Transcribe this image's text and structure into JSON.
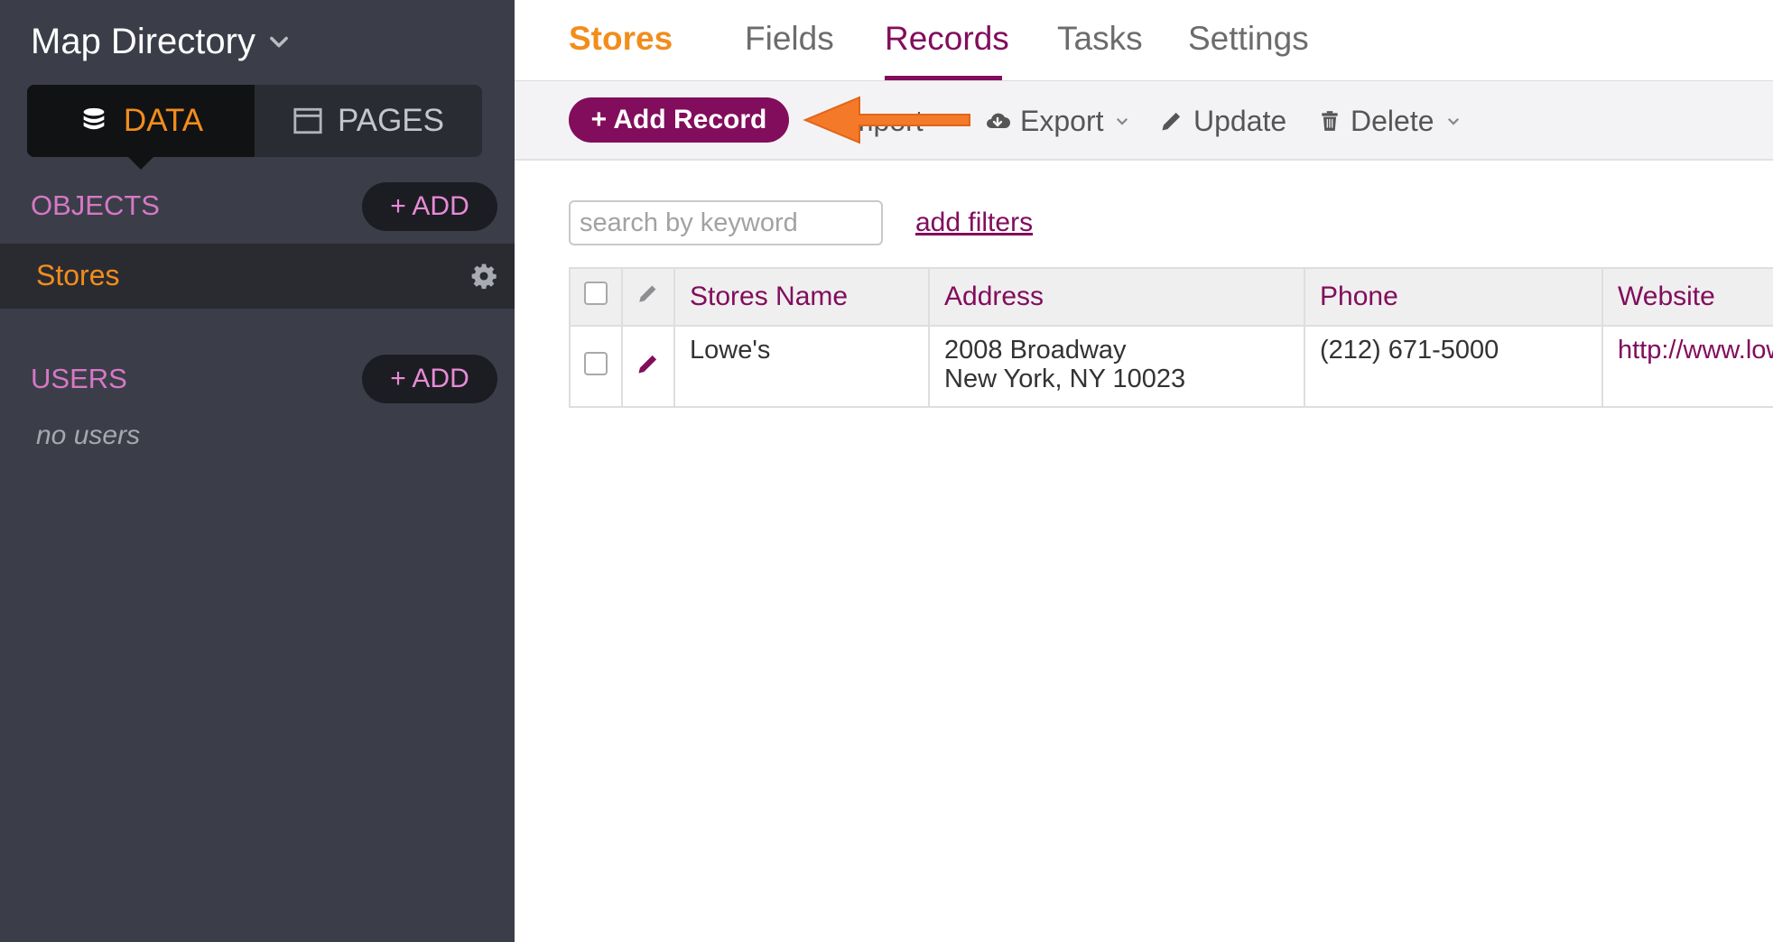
{
  "app": {
    "title": "Map Directory"
  },
  "sidebar": {
    "segments": [
      {
        "label": "DATA",
        "icon": "database-icon",
        "active": true
      },
      {
        "label": "PAGES",
        "icon": "window-icon",
        "active": false
      }
    ],
    "objects_section": {
      "label": "OBJECTS",
      "add_label": "+ ADD"
    },
    "objects": [
      {
        "name": "Stores",
        "icon": "gear-icon"
      }
    ],
    "users_section": {
      "label": "USERS",
      "add_label": "+ ADD",
      "empty_text": "no users"
    }
  },
  "object_title": "Stores",
  "tabs": [
    {
      "label": "Fields",
      "active": false
    },
    {
      "label": "Records",
      "active": true
    },
    {
      "label": "Tasks",
      "active": false
    },
    {
      "label": "Settings",
      "active": false
    }
  ],
  "toolbar": {
    "add_record_label": "+ Add Record",
    "import_label": "Import",
    "export_label": "Export",
    "update_label": "Update",
    "delete_label": "Delete"
  },
  "search": {
    "placeholder": "search by keyword",
    "value": ""
  },
  "filters_link": "add filters",
  "table": {
    "columns": [
      "Stores Name",
      "Address",
      "Phone",
      "Website"
    ],
    "rows": [
      {
        "name": "Lowe's",
        "address_line1": "2008 Broadway",
        "address_line2": "New York, NY 10023",
        "phone": "(212) 671-5000",
        "website": "http://www.low"
      }
    ]
  },
  "colors": {
    "sidebar_bg": "#3b3e48",
    "accent_orange": "#f28d1c",
    "brand_purple": "#820d5c",
    "section_pink": "#d678c6",
    "annotation_arrow": "#f47a2a"
  }
}
